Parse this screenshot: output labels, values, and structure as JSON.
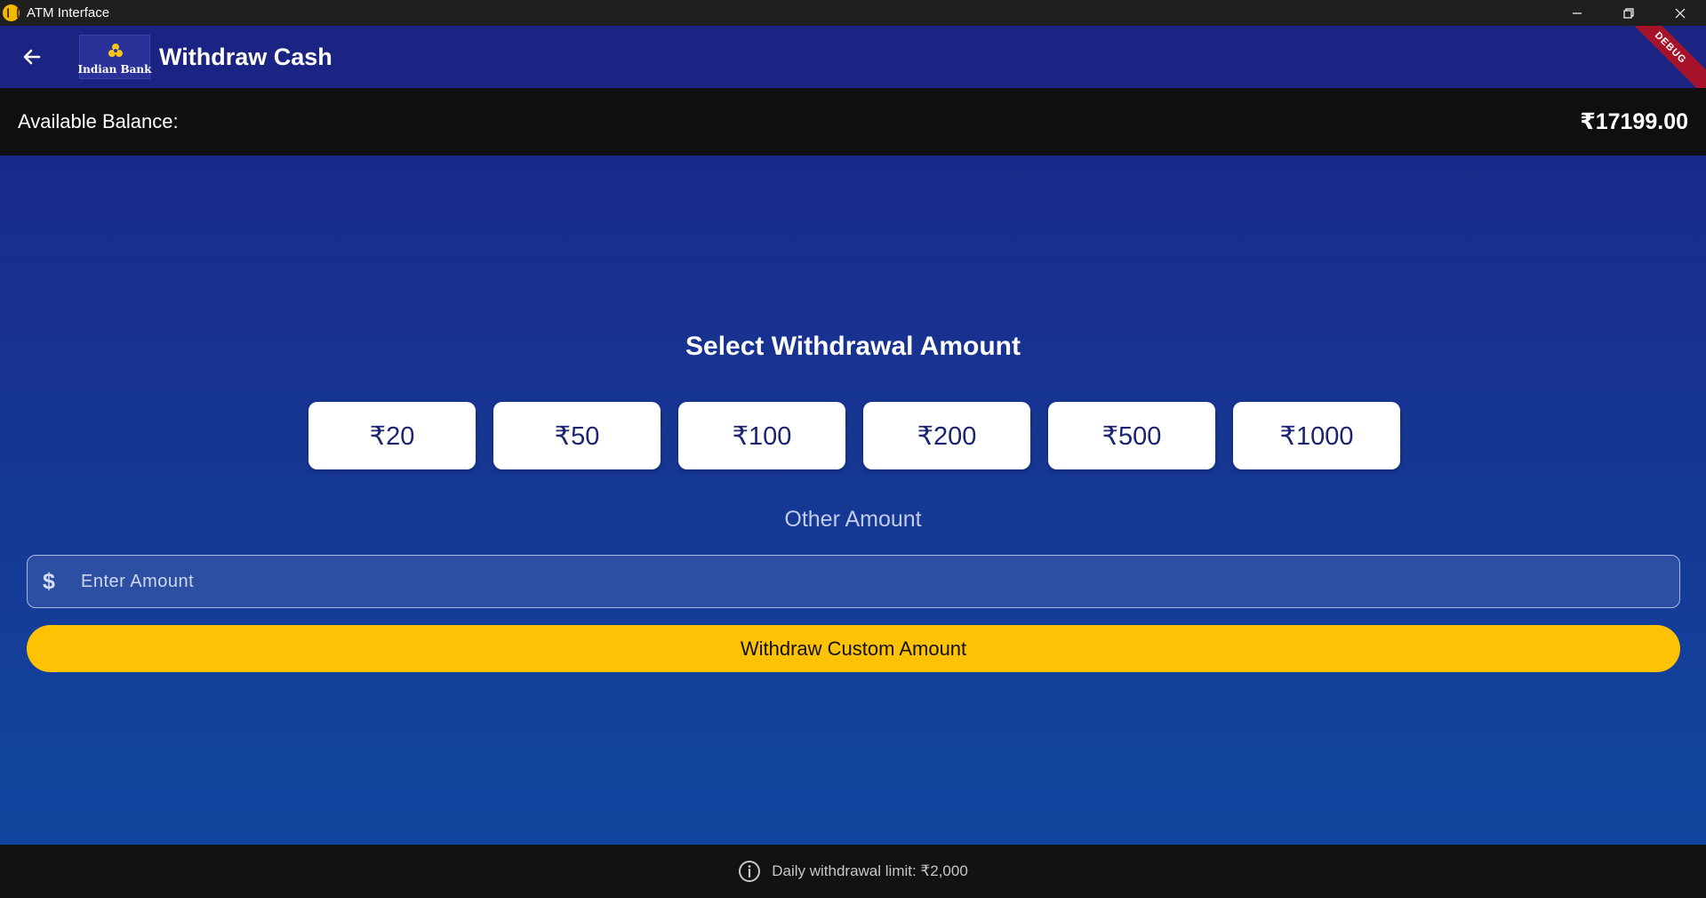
{
  "window": {
    "title": "ATM Interface"
  },
  "appbar": {
    "title": "Withdraw Cash",
    "logo_text": "Indian Bank",
    "debug_label": "DEBUG"
  },
  "balance": {
    "label": "Available Balance:",
    "value": "₹17199.00"
  },
  "main": {
    "section_title": "Select Withdrawal Amount",
    "amounts": [
      "₹20",
      "₹50",
      "₹100",
      "₹200",
      "₹500",
      "₹1000"
    ],
    "other_label": "Other Amount",
    "input_icon": "dollar-icon",
    "input_placeholder": "Enter Amount",
    "custom_button_label": "Withdraw Custom Amount"
  },
  "footer": {
    "icon": "info-icon",
    "limit_text": "Daily withdrawal limit: ₹2,000"
  },
  "colors": {
    "appbar": "#1b2482",
    "accent_button": "#fdc203",
    "amount_text": "#1b2470",
    "debug_banner": "#a5122a"
  }
}
